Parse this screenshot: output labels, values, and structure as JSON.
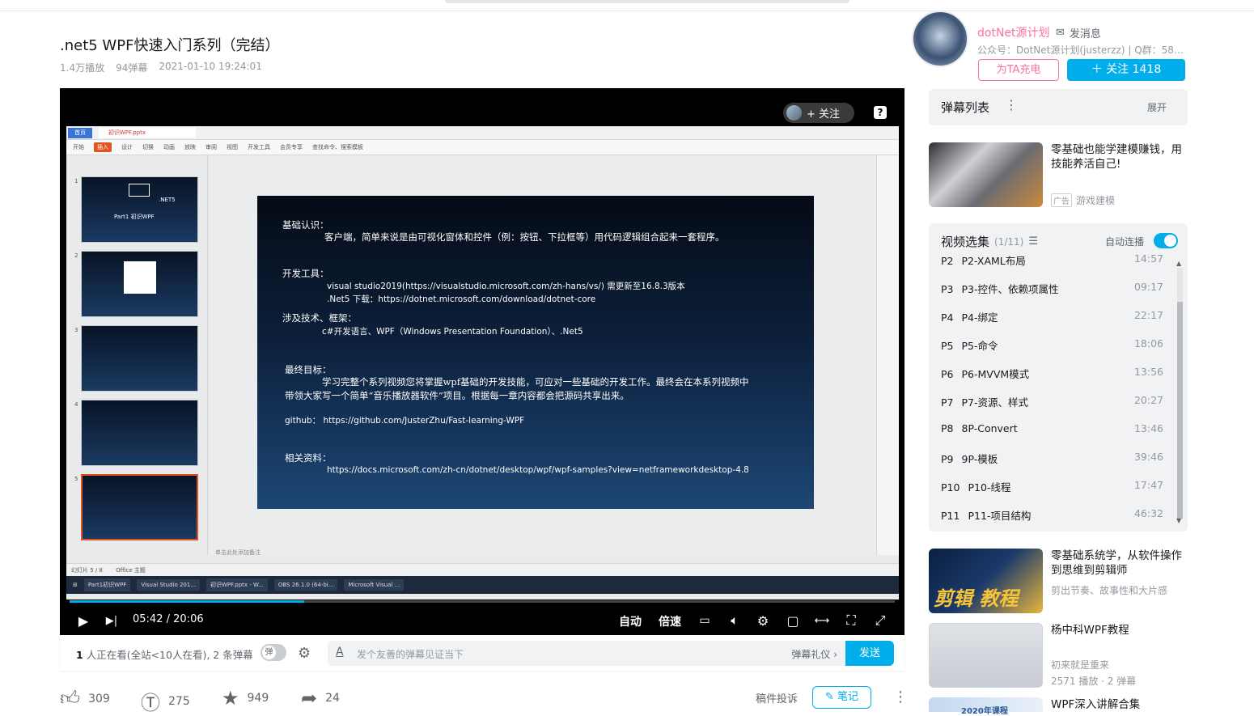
{
  "video": {
    "title": ".net5 WPF快速入门系列（完结）",
    "plays": "1.4万播放",
    "danmaku_count": "94弹幕",
    "date": "2021-01-10 19:24:01"
  },
  "player": {
    "follow_label": "+ 关注",
    "help_label": "?",
    "current_time": "05:42",
    "separator": "/",
    "total_time": "20:06",
    "progress_fraction": 0.284,
    "auto_label": "自动",
    "speed_label": "倍速"
  },
  "screen": {
    "home_tab": "首页",
    "file_tab": "初识WPF.pptx",
    "ribbon": [
      "开始",
      "插入",
      "设计",
      "切换",
      "动画",
      "放映",
      "审阅",
      "视图",
      "开发工具",
      "会员专享",
      "查找命令、搜索模板"
    ],
    "ribbon_active": "插入",
    "thumb1_title": "Part1    初识WPF",
    "thumb1_sub": ".NET5",
    "notes_hint": "单击此处添加备注",
    "status_left": "幻灯片 5 / 8",
    "status_office": "Office 主题",
    "taskbar": [
      "Part1初识WPF",
      "Visual Studio 201...",
      "初识WPF.pptx - W...",
      "OBS 26.1.0 (64-bi...",
      "Microsoft Visual ..."
    ],
    "slide_lines": [
      "基础认识：",
      "客户端，简单来说是由可视化窗体和控件（例：按钮、下拉框等）用代码逻辑组合起来一套程序。",
      "开发工具：",
      "visual studio2019(https://visualstudio.microsoft.com/zh-hans/vs/) 需更新至16.8.3版本",
      ".Net5 下载：https://dotnet.microsoft.com/download/dotnet-core",
      "涉及技术、框架：",
      "c#开发语言、WPF（Windows Presentation Foundation）、.Net5",
      "最终目标：",
      "学习完整个系列视频您将掌握wpf基础的开发技能，可应对一些基础的开发工作。最终会在本系列视频中",
      "带领大家写一个简单“音乐播放器软件”项目。根据每一章内容都会把源码共享出来。",
      "github：  https://github.com/JusterZhu/Fast-learning-WPF",
      "相关资料：",
      "https://docs.microsoft.com/zh-cn/dotnet/desktop/wpf/wpf-samples?view=netframeworkdesktop-4.8"
    ]
  },
  "sendbar": {
    "watching_count": "1",
    "watching_text": "人正在看(全站<10人在看), 2 条弹幕",
    "danmaku_toggle": "弹",
    "input_placeholder": "发个友善的弹幕见证当下",
    "etiquette": "弹幕礼仪 ›",
    "send_label": "发送"
  },
  "actions": {
    "like": "309",
    "coin": "275",
    "favorite": "949",
    "share": "24",
    "report": "稿件投诉",
    "note": "笔记"
  },
  "uploader": {
    "name": "dotNet源计划",
    "message": "发消息",
    "desc": "公众号：DotNet源计划(justerzz) | Q群：5807...",
    "charge": "为TA充电",
    "follow": "关注 1418"
  },
  "danmaku_list": {
    "title": "弹幕列表",
    "expand": "展开"
  },
  "ad1": {
    "title": "零基础也能学建模赚钱，用技能养活自己!",
    "badge": "广告",
    "source": "游戏建模"
  },
  "playlist": {
    "title": "视频选集",
    "count": "(1/11)",
    "autoplay": "自动连播",
    "items": [
      {
        "p": "P2",
        "name": "P2-XAML布局",
        "dur": "14:57"
      },
      {
        "p": "P3",
        "name": "P3-控件、依赖项属性",
        "dur": "09:17"
      },
      {
        "p": "P4",
        "name": "P4-绑定",
        "dur": "22:17"
      },
      {
        "p": "P5",
        "name": "P5-命令",
        "dur": "18:06"
      },
      {
        "p": "P6",
        "name": "P6-MVVM模式",
        "dur": "13:56"
      },
      {
        "p": "P7",
        "name": "P7-资源、样式",
        "dur": "20:27"
      },
      {
        "p": "P8",
        "name": "8P-Convert",
        "dur": "13:46"
      },
      {
        "p": "P9",
        "name": "9P-模板",
        "dur": "39:46"
      },
      {
        "p": "P10",
        "name": "P10-线程",
        "dur": "17:47"
      },
      {
        "p": "P11",
        "name": "P11-项目结构",
        "dur": "46:32"
      }
    ]
  },
  "rec1": {
    "title": "零基础系统学，从软件操作到思维到剪辑师",
    "sub": "剪出节奏、故事性和大片感",
    "thumb_text": "剪辑 教程"
  },
  "rec2": {
    "title": "杨中科WPF教程",
    "author": "初来就是重来",
    "stats": "2571 播放 · 2 弹幕"
  },
  "rec3": {
    "title": "WPF深入讲解合集",
    "thumb_text": "2020年课程"
  },
  "colors": {
    "accent": "#00aeec",
    "pink": "#fb7299"
  }
}
